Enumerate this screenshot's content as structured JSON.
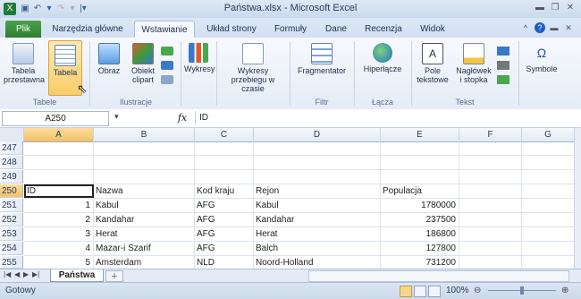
{
  "window": {
    "title": "Państwa.xlsx - Microsoft Excel"
  },
  "tabs": [
    "Plik",
    "Narzędzia główne",
    "Wstawianie",
    "Układ strony",
    "Formuły",
    "Dane",
    "Recenzja",
    "Widok"
  ],
  "ribbon": {
    "buttons": {
      "pivot": "Tabela przestawna",
      "table": "Tabela",
      "picture": "Obraz",
      "clipart": "Obiekt clipart",
      "charts": "Wykresy",
      "sparklines": "Wykresy przebiegu w czasie",
      "slicer": "Fragmentator",
      "hyperlink": "Hiperłącze",
      "textbox": "Pole tekstowe",
      "headerfooter": "Nagłówek i stopka",
      "symbols": "Symbole"
    },
    "groups": {
      "tables": "Tabele",
      "illustrations": "Ilustracje",
      "filter": "Filtr",
      "links": "Łącza",
      "text": "Tekst"
    }
  },
  "formula_bar": {
    "name_box": "A250",
    "fx": "fx",
    "formula": "ID"
  },
  "columns": [
    "A",
    "B",
    "C",
    "D",
    "E",
    "F",
    "G"
  ],
  "rows": [
    "247",
    "248",
    "249",
    "250",
    "251",
    "252",
    "253",
    "254",
    "255"
  ],
  "table": {
    "header": {
      "id": "ID",
      "name": "Nazwa",
      "code": "Kod kraju",
      "region": "Rejon",
      "pop": "Populacja"
    },
    "data": [
      {
        "id": "1",
        "name": "Kabul",
        "code": "AFG",
        "region": "Kabul",
        "pop": "1780000"
      },
      {
        "id": "2",
        "name": "Kandahar",
        "code": "AFG",
        "region": "Kandahar",
        "pop": "237500"
      },
      {
        "id": "3",
        "name": "Herat",
        "code": "AFG",
        "region": "Herat",
        "pop": "186800"
      },
      {
        "id": "4",
        "name": "Mazar-i Szarif",
        "code": "AFG",
        "region": "Balch",
        "pop": "127800"
      },
      {
        "id": "5",
        "name": "Amsterdam",
        "code": "NLD",
        "region": "Noord-Holland",
        "pop": "731200"
      }
    ]
  },
  "sheet": {
    "name": "Państwa"
  },
  "status": {
    "text": "Gotowy",
    "zoom": "100%"
  },
  "colors": {
    "file_tab": "#2e7d32",
    "selection_header": "#f3c265",
    "ribbon_bg": "#e4ecf7"
  }
}
